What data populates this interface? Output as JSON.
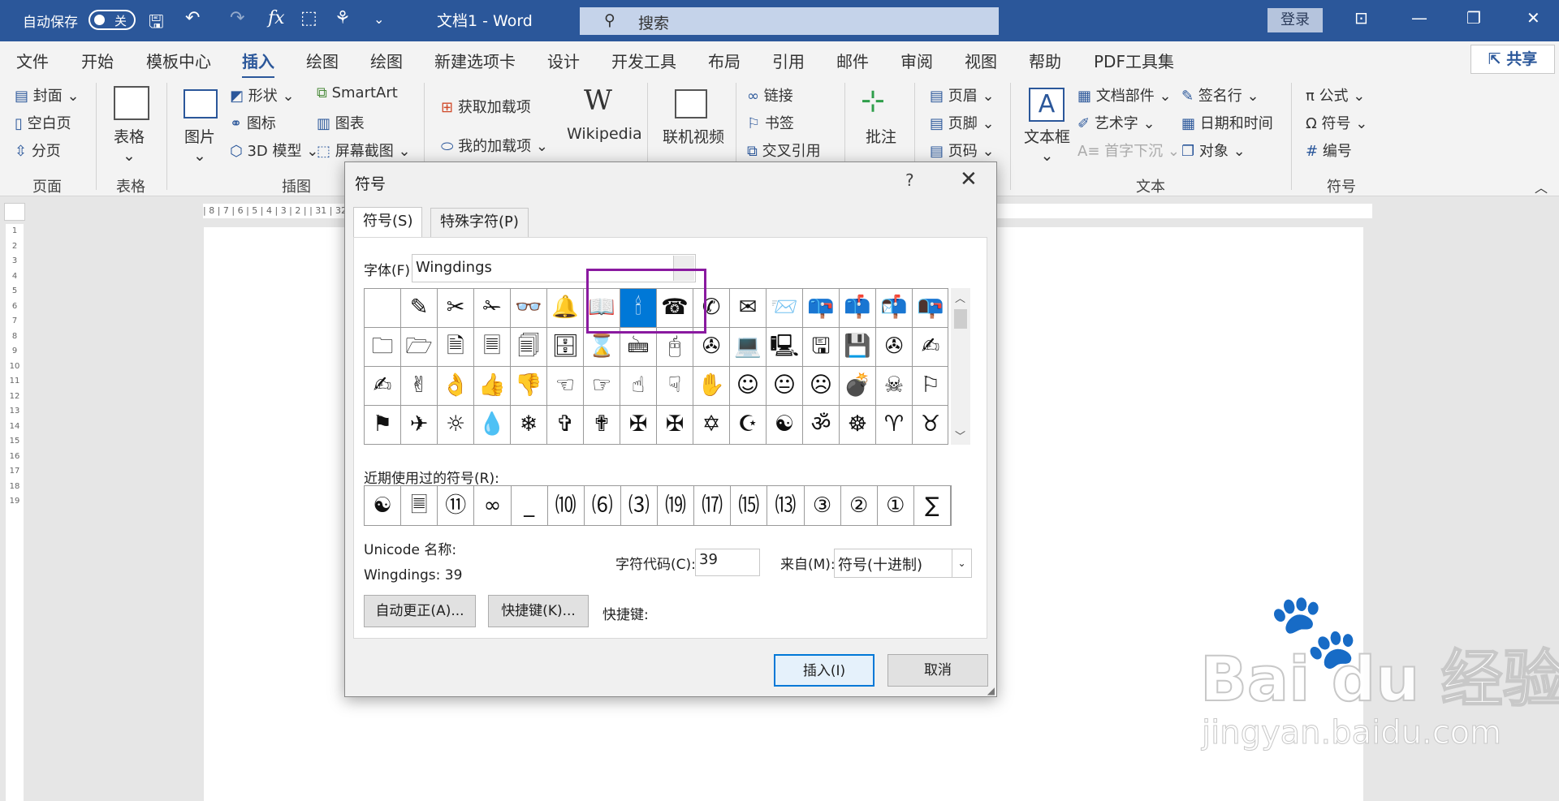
{
  "titlebar": {
    "autosave": "自动保存",
    "toggle": "关",
    "doc_title": "文档1 - Word",
    "search_placeholder": "搜索",
    "login": "登录",
    "fx": "fx"
  },
  "menu": [
    "文件",
    "开始",
    "模板中心",
    "插入",
    "绘图",
    "绘图",
    "新建选项卡",
    "设计",
    "开发工具",
    "布局",
    "引用",
    "邮件",
    "审阅",
    "视图",
    "帮助",
    "PDF工具集"
  ],
  "share": "共享",
  "ribbon": {
    "pages": [
      "封面",
      "空白页",
      "分页"
    ],
    "group_pages": "页面",
    "table": "表格",
    "group_table": "表格",
    "picture": "图片",
    "shapes": "形状",
    "icons": "图标",
    "model3d": "3D 模型",
    "smartart": "SmartArt",
    "chart": "图表",
    "screenshot": "屏幕截图",
    "group_illus": "插图",
    "get_addins": "获取加载项",
    "my_addins": "我的加载项",
    "wikipedia": "Wikipedia",
    "online_video": "联机视频",
    "link": "链接",
    "bookmark": "书签",
    "crossref": "交叉引用",
    "comment": "批注",
    "header": "页眉",
    "footer": "页脚",
    "pagenum": "页码",
    "textbox": "文本框",
    "quickparts": "文档部件",
    "wordart": "艺术字",
    "dropcap": "首字下沉",
    "sigline": "签名行",
    "datetime": "日期和时间",
    "object": "对象",
    "group_text": "文本",
    "equation": "公式",
    "symbol": "符号",
    "number": "编号",
    "group_symbols": "符号"
  },
  "ruler": {
    "h": "| 8 | 7 | 6 | 5 | 4 | 3 | 2 |                                                                                                                                                                                            | 31 | 32 | 33 | 34 | 35 | 36 | 37 | 38 | 39 | 40 | 41 | 42 | 43 | 44 | 45 | 46 | 47 | 48",
    "v": [
      "1",
      "2",
      "3",
      "4",
      "5",
      "6",
      "7",
      "8",
      "9",
      "10",
      "11",
      "12",
      "13",
      "14",
      "15",
      "16",
      "17",
      "18",
      "19"
    ]
  },
  "dialog": {
    "title": "符号",
    "help": "?",
    "close": "✕",
    "tab_symbols": "符号(S)",
    "tab_special": "特殊字符(P)",
    "font_label": "字体(F):",
    "font_value": "Wingdings",
    "symbols": [
      "",
      "✎",
      "✂",
      "✁",
      "👓",
      "🔔",
      "📖",
      "🕯",
      "☎",
      "✆",
      "✉",
      "📨",
      "📪",
      "📫",
      "📬",
      "📭",
      "🗀",
      "🗁",
      "🗎",
      "🗏",
      "🗐",
      "🗄",
      "⌛",
      "🖮",
      "🖰",
      "✇",
      "💻",
      "🖳",
      "🖫",
      "💾",
      "✇",
      "✍",
      "✍",
      "✌",
      "👌",
      "👍",
      "👎",
      "☜",
      "☞",
      "☝",
      "☟",
      "✋",
      "☺",
      "😐",
      "☹",
      "💣",
      "☠",
      "⚐",
      "⚑",
      "✈",
      "☼",
      "💧",
      "❄",
      "✞",
      "✟",
      "✠",
      "✠",
      "✡",
      "☪",
      "☯",
      "ॐ",
      "☸",
      "♈",
      "♉"
    ],
    "selected_index": 7,
    "recent_label": "近期使用过的符号(R):",
    "recent": [
      "☯",
      "🗏",
      "⑪",
      "∞",
      "_",
      "⑽",
      "⑹",
      "⑶",
      "⒆",
      "⒄",
      "⒂",
      "⒀",
      "③",
      "②",
      "①",
      "∑"
    ],
    "unicode_name_label": "Unicode 名称:",
    "unicode_name": "Wingdings: 39",
    "charcode_label": "字符代码(C):",
    "charcode": "39",
    "from_label": "来自(M):",
    "from_value": "符号(十进制)",
    "autocorrect": "自动更正(A)...",
    "shortcut_btn": "快捷键(K)...",
    "shortcut_label": "快捷键:",
    "insert": "插入(I)",
    "cancel": "取消"
  },
  "watermark": {
    "logo": "Bai du 经验",
    "url": "jingyan.baidu.com"
  }
}
